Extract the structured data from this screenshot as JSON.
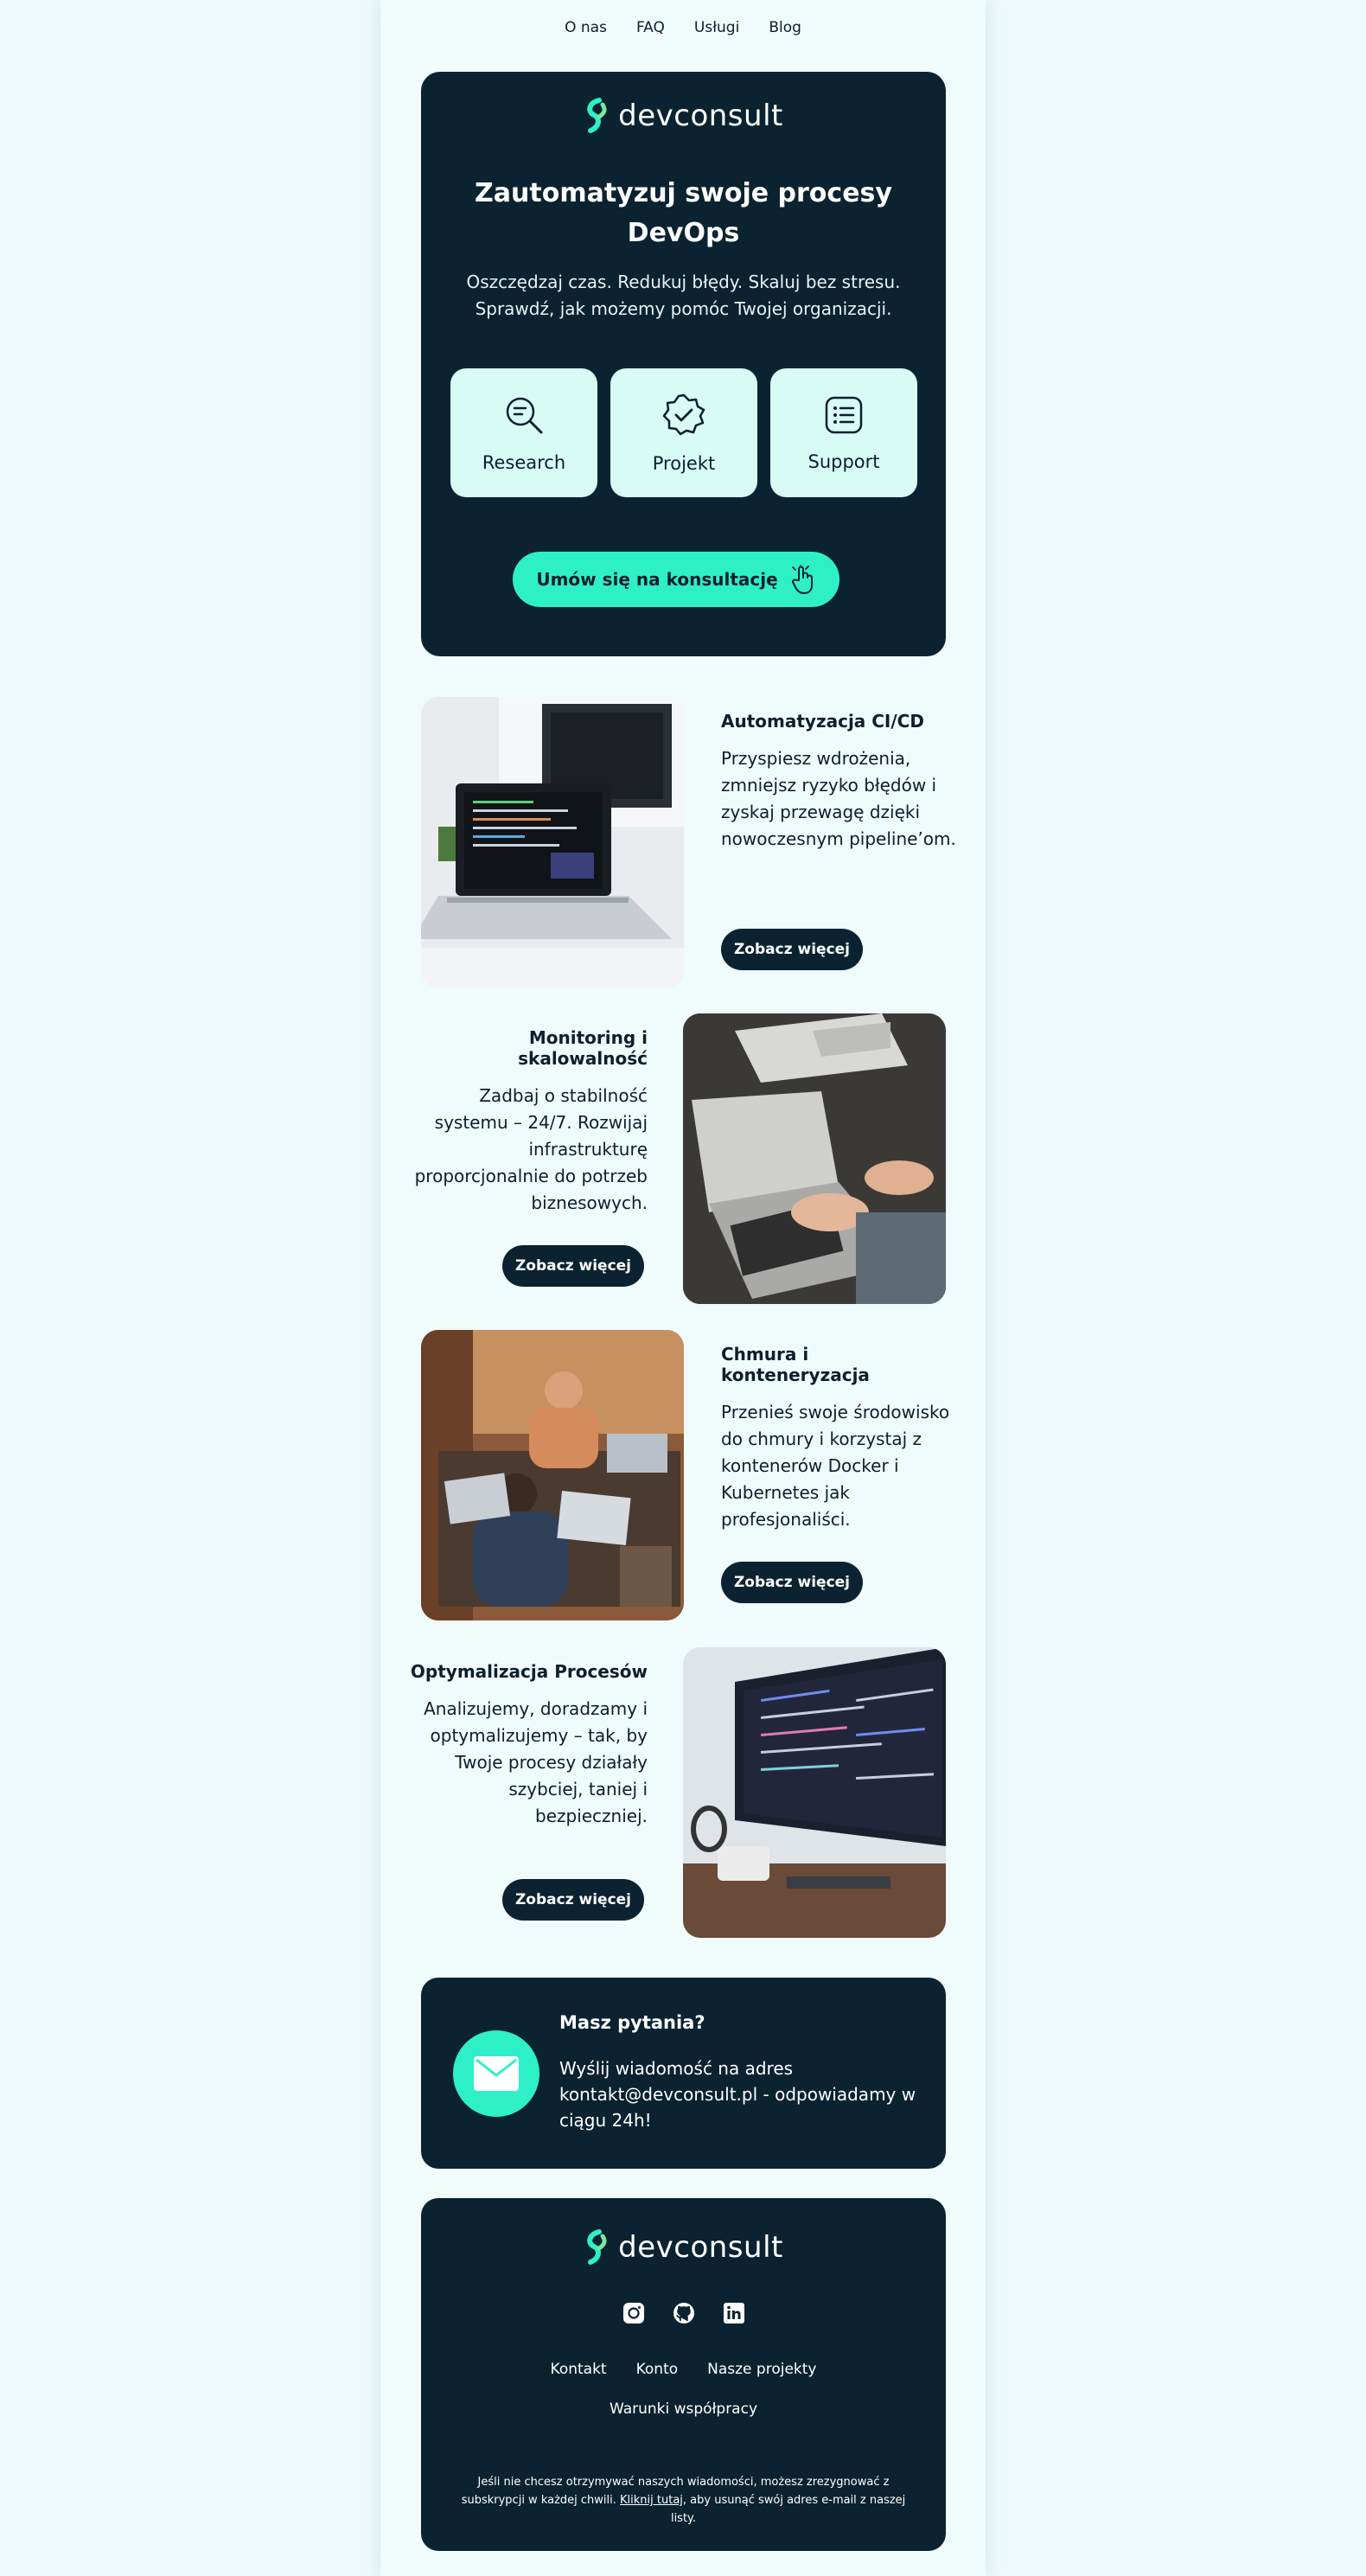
{
  "nav": [
    "O nas",
    "FAQ",
    "Usługi",
    "Blog"
  ],
  "brand": {
    "name": "devconsult",
    "accent": "#2ef0c8",
    "dark": "#0b2330"
  },
  "hero": {
    "title": "Zautomatyzuj swoje procesy DevOps",
    "subtitle": "Oszczędzaj czas. Redukuj błędy. Skaluj bez stresu. Sprawdź, jak możemy pomóc Twojej organizacji.",
    "cards": [
      {
        "label": "Research",
        "icon": "research-icon"
      },
      {
        "label": "Projekt",
        "icon": "badge-check-icon"
      },
      {
        "label": "Support",
        "icon": "list-icon"
      }
    ],
    "cta": "Umów się na konsultację"
  },
  "features": [
    {
      "title": "Automatyzacja CI/CD",
      "text": "Przyspiesz wdrożenia, zmniejsz ryzyko błędów i zyskaj przewagę dzięki nowoczesnym pipeline’om.",
      "button": "Zobacz więcej"
    },
    {
      "title": "Monitoring i skalowalność",
      "text": "Zadbaj o stabilność systemu – 24/7. Rozwijaj infrastrukturę proporcjonalnie do potrzeb biznesowych.",
      "button": "Zobacz więcej"
    },
    {
      "title": "Chmura i konteneryzacja",
      "text": "Przenieś swoje środowisko do chmury i korzystaj z kontenerów Docker i Kubernetes jak profesjonaliści.",
      "button": "Zobacz więcej"
    },
    {
      "title": "Optymalizacja Procesów",
      "text": "Analizujemy, doradzamy i optymalizujemy – tak, by Twoje procesy działały szybciej, taniej i bezpieczniej.",
      "button": "Zobacz więcej"
    }
  ],
  "contact": {
    "title": "Masz pytania?",
    "text": "Wyślij wiadomość na adres kontakt@devconsult.pl - odpowiadamy w ciągu 24h!"
  },
  "footer": {
    "links": [
      "Kontakt",
      "Konto",
      "Nasze projekty"
    ],
    "terms": "Warunki współpracy",
    "unsubscribe_before": "Jeśli nie chcesz otrzymywać naszych wiadomości, możesz zrezygnować z subskrypcji w każdej chwili. ",
    "unsubscribe_link": "Kliknij tutaj",
    "unsubscribe_after": ", aby usunąć swój adres e-mail z naszej listy."
  }
}
